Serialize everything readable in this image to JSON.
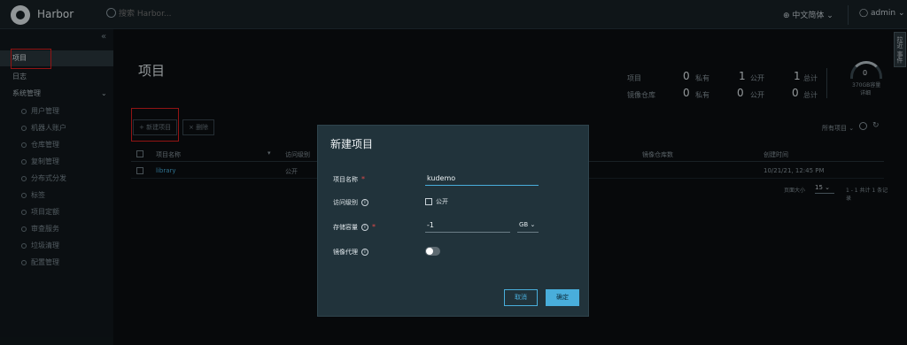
{
  "header": {
    "brand": "Harbor",
    "search_placeholder": "搜索 Harbor...",
    "language": "中文简体",
    "user": "admin"
  },
  "sidebar": {
    "items": [
      {
        "label": "项目"
      },
      {
        "label": "日志"
      },
      {
        "label": "系统管理"
      }
    ],
    "subitems": [
      {
        "label": "用户管理"
      },
      {
        "label": "机器人账户"
      },
      {
        "label": "仓库管理"
      },
      {
        "label": "复制管理"
      },
      {
        "label": "分布式分发"
      },
      {
        "label": "标签"
      },
      {
        "label": "项目定额"
      },
      {
        "label": "审查服务"
      },
      {
        "label": "垃圾清理"
      },
      {
        "label": "配置管理"
      }
    ]
  },
  "main": {
    "title": "项目",
    "stats": {
      "projects_label": "项目",
      "repos_label": "镜像仓库",
      "private_label": "私有",
      "public_label": "公开",
      "total_label": "总计",
      "projects_private": "0",
      "projects_public": "1",
      "projects_total": "1",
      "repos_private": "0",
      "repos_public": "0",
      "repos_total": "0"
    },
    "gauge": {
      "value": "0",
      "capacity": "370GB容量",
      "detail": "详细"
    },
    "new_project_button": "+ 新建项目",
    "delete_button": "× 删除",
    "filter": "所有项目",
    "table": {
      "headers": [
        "项目名称",
        "访问级别",
        "镜像仓库数",
        "创建时间"
      ],
      "rows": [
        {
          "name": "library",
          "access": "公开",
          "created": "10/21/21, 12:45 PM"
        }
      ],
      "page_size_label": "页面大小",
      "page_size": "15",
      "pagination": "1 - 1 共计 1 条记录"
    }
  },
  "modal": {
    "title": "新建项目",
    "project_name_label": "项目名称",
    "project_name_value": "kudemo",
    "access_label": "访问级别",
    "public_label": "公开",
    "quota_label": "存储容量",
    "quota_value": "-1",
    "quota_unit": "GB",
    "proxy_label": "镜像代理",
    "cancel": "取消",
    "ok": "确定"
  },
  "right_tab": "拉近 事件"
}
